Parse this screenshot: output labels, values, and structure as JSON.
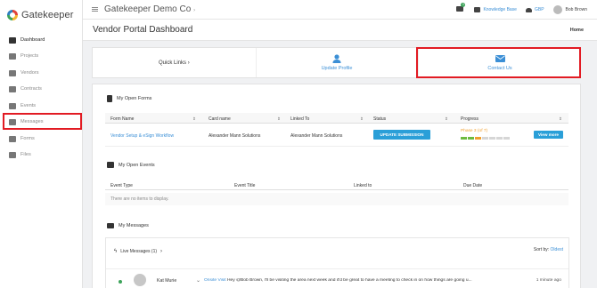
{
  "app": {
    "brand": "Gatekeeper",
    "company": "Gatekeeper Demo Co"
  },
  "sidebar": {
    "items": [
      {
        "label": "Dashboard",
        "icon": "dashboard-icon"
      },
      {
        "label": "Projects",
        "icon": "projects-icon"
      },
      {
        "label": "Vendors",
        "icon": "vendors-icon"
      },
      {
        "label": "Contracts",
        "icon": "contracts-icon"
      },
      {
        "label": "Events",
        "icon": "flag-icon"
      },
      {
        "label": "Messages",
        "icon": "envelope-icon"
      },
      {
        "label": "Forms",
        "icon": "forms-icon"
      },
      {
        "label": "Files",
        "icon": "files-icon"
      }
    ]
  },
  "topbar": {
    "notification_count": "1",
    "knowledge_base": "Knowledge Base",
    "currency": "GBP",
    "user": "Bob Brown"
  },
  "page": {
    "title": "Vendor Portal Dashboard",
    "breadcrumb": "Home"
  },
  "quick_links": {
    "label": "Quick Links",
    "update_profile": "Update Profile",
    "contact_us": "Contact Us"
  },
  "forms": {
    "title": "My Open Forms",
    "columns": [
      "Form Name",
      "Card name",
      "Linked To",
      "Status",
      "Progress"
    ],
    "row": {
      "form_name": "Vendor Setup & eSign Workflow",
      "card_name": "Alexander Mann Solutions",
      "linked_to": "Alexander Mann Solutions",
      "status_button": "UPDATE SUBMISSION",
      "phase": "Phase 3 (of 7)",
      "progress_completed": 3,
      "progress_total": 7,
      "view_more": "View more"
    }
  },
  "events": {
    "title": "My Open Events",
    "columns": [
      "Event Type",
      "Event Title",
      "Linked to",
      "Due Date"
    ],
    "empty": "There are no items to display."
  },
  "messages": {
    "title": "My Messages",
    "live_label": "Live Messages (1)",
    "sort_label": "Sort by:",
    "sort_value": "Oldest",
    "item": {
      "sender": "Kat Murie",
      "subject": "Onsite Visit",
      "preview": "Hey @Bob Brown, I'll be visiting the area next week and it'd be great to have a meeting to check in on how things are going u...",
      "time": "1 minute ago"
    }
  },
  "colors": {
    "accent": "#2a9fd8",
    "highlight": "#e21b23",
    "progress_done": "#6dbb3f",
    "progress_current": "#f0a030"
  }
}
